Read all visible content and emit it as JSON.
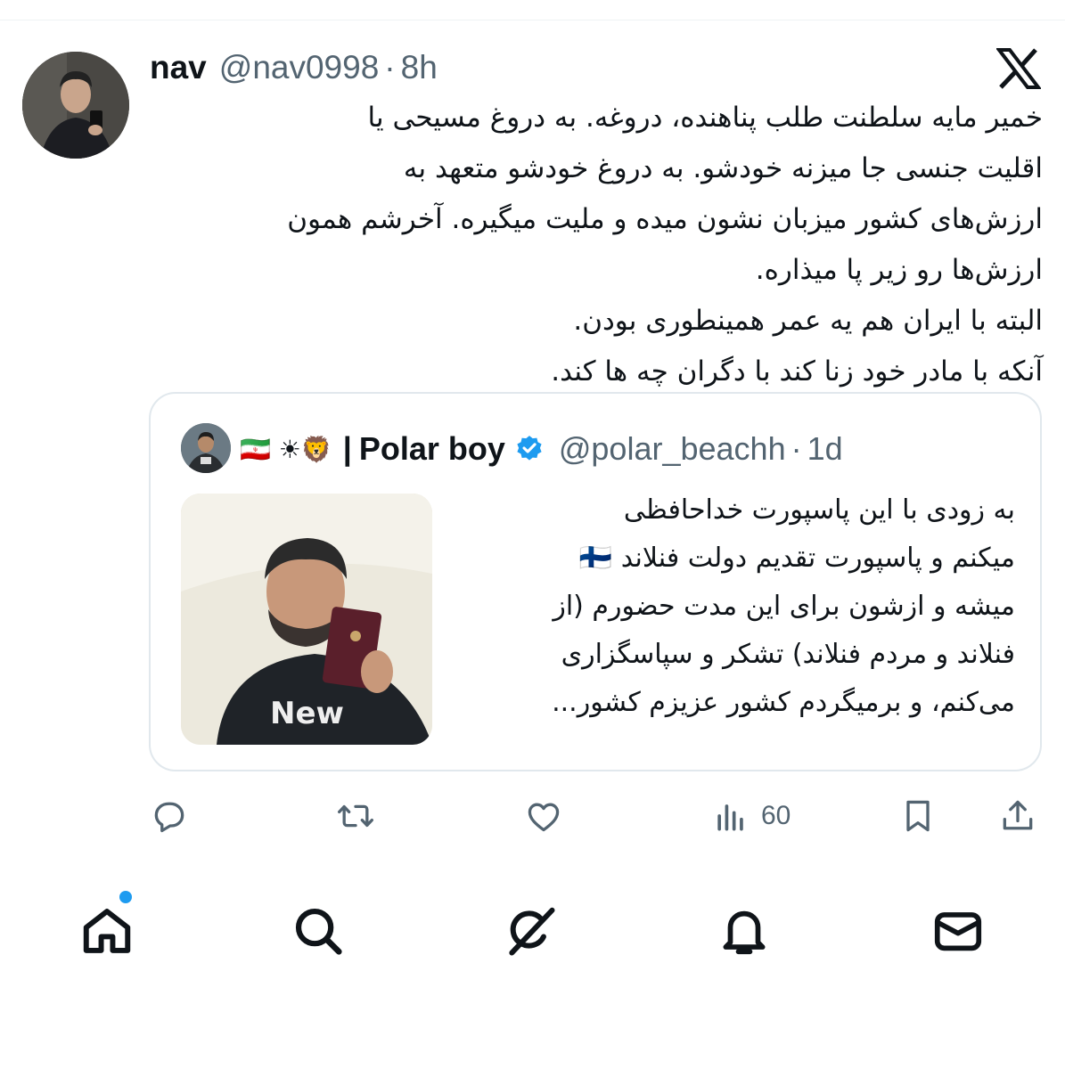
{
  "tweet": {
    "display_name": "nav",
    "handle": "@nav0998",
    "separator": "·",
    "time": "8h",
    "text_lines": [
      "خمیر مایه سلطنت طلب پناهنده، دروغه. به دروغ مسیحی یا",
      "اقلیت جنسی جا میزنه خودشو. به دروغ خودشو متعهد به",
      "ارزش‌های کشور میزبان نشون میده و ملیت میگیره. آخرشم همون",
      "ارزش‌ها رو زیر پا میذاره.",
      "البته با ایران هم یه عمر همینطوری بودن.",
      "آنکه با مادر خود زنا کند با دگران چه ها کند."
    ]
  },
  "quote": {
    "emojis": "🇮🇷 ☀🦁",
    "separator_bar": "|",
    "display_name": "Polar boy",
    "handle": "@polar_beachh",
    "separator": "·",
    "time": "1d",
    "text_lines": [
      "به زودی با این پاسپورت خداحافظی",
      "میکنم و پاسپورت تقدیم دولت فنلاند 🇫🇮",
      "میشه و ازشون برای این مدت حضورم (از",
      "فنلاند و مردم فنلاند) تشکر و سپاسگزاری",
      "می‌کنم، و برمیگردم کشور عزیزم کشور..."
    ]
  },
  "actions": {
    "views_count": "60"
  },
  "colors": {
    "text": "#0f1419",
    "secondary": "#536471",
    "accent_blue": "#1d9bf0",
    "border": "#e1e8ed"
  },
  "icons": {
    "reply": "reply-icon",
    "retweet": "retweet-icon",
    "like": "like-icon",
    "views": "views-icon",
    "bookmark": "bookmark-icon",
    "share": "share-icon",
    "home": "home-icon",
    "search": "search-icon",
    "grok": "grok-icon",
    "notifications": "bell-icon",
    "messages": "mail-icon"
  }
}
